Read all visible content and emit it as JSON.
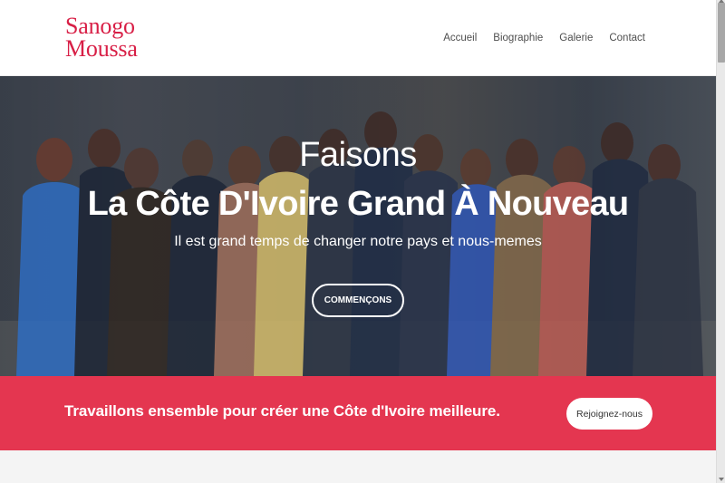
{
  "brand": {
    "line1": "Sanogo",
    "line2": "Moussa"
  },
  "nav": {
    "items": [
      "Accueil",
      "Biographie",
      "Galerie",
      "Contact"
    ]
  },
  "hero": {
    "subtitle": "Faisons",
    "title": "La Côte D'Ivoire Grand À Nouveau",
    "text": "Il est grand temps de changer notre pays et nous-memes",
    "button": "COMMENÇONS"
  },
  "cta": {
    "text": "Travaillons ensemble pour créer une Côte d'Ivoire meilleure.",
    "button": "Rejoignez-nous"
  },
  "colors": {
    "accent": "#d81f46",
    "cta_background": "#e43650"
  }
}
